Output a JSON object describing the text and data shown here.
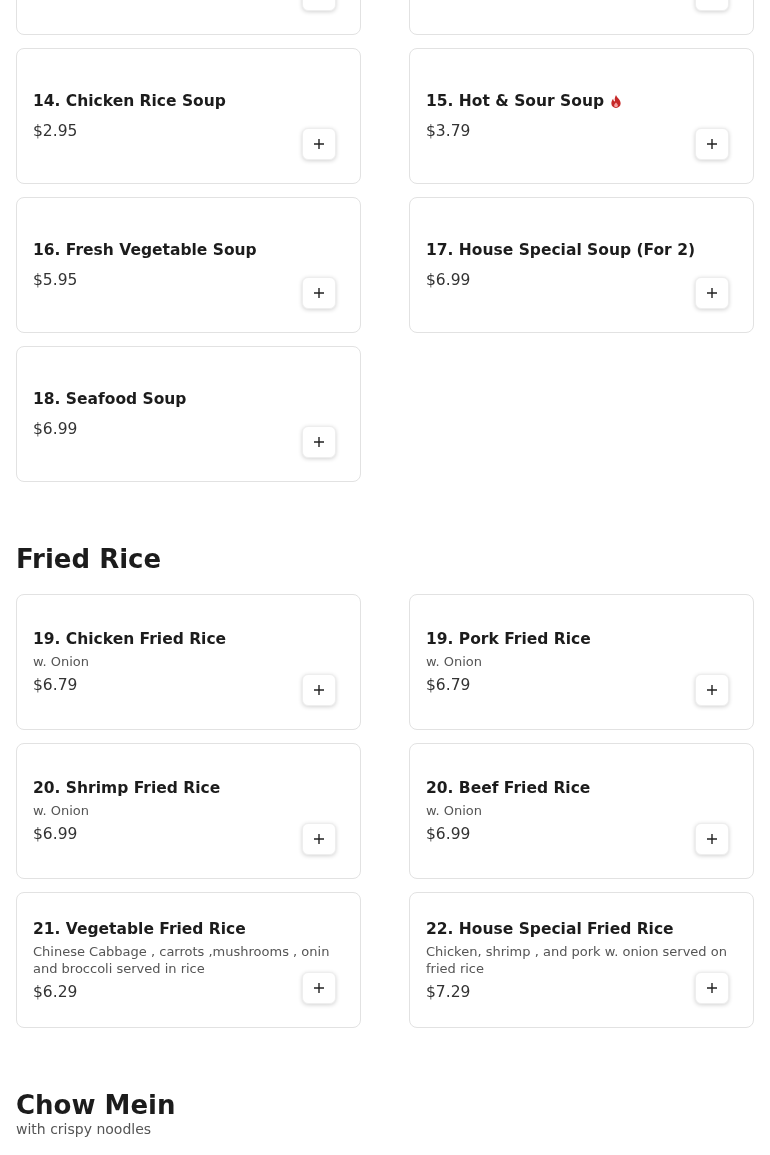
{
  "sections": [
    {
      "items": [
        {
          "kind": "cut"
        },
        {
          "kind": "cut"
        },
        {
          "kind": "dish",
          "name": "14. Chicken Rice Soup",
          "price": "$2.95",
          "spicy": false
        },
        {
          "kind": "dish",
          "name": "15. Hot & Sour Soup",
          "price": "$3.79",
          "spicy": true
        },
        {
          "kind": "dish",
          "name": "16. Fresh Vegetable Soup",
          "price": "$5.95",
          "spicy": false
        },
        {
          "kind": "dish",
          "name": "17. House Special Soup (For 2)",
          "price": "$6.99",
          "spicy": false
        },
        {
          "kind": "dish",
          "name": "18. Seafood Soup",
          "price": "$6.99",
          "spicy": false
        }
      ]
    },
    {
      "title": "Fried Rice",
      "items": [
        {
          "kind": "dish",
          "name": "19. Chicken Fried Rice",
          "description": "w. Onion",
          "price": "$6.79",
          "spicy": false
        },
        {
          "kind": "dish",
          "name": "19. Pork Fried Rice",
          "description": "w. Onion",
          "price": "$6.79",
          "spicy": false
        },
        {
          "kind": "dish",
          "name": "20. Shrimp Fried Rice",
          "description": "w. Onion",
          "price": "$6.99",
          "spicy": false
        },
        {
          "kind": "dish",
          "name": "20. Beef Fried Rice",
          "description": "w. Onion",
          "price": "$6.99",
          "spicy": false
        },
        {
          "kind": "dish",
          "name": "21. Vegetable Fried Rice",
          "description": "Chinese Cabbage , carrots ,mushrooms , onin and broccoli served in rice",
          "price": "$6.29",
          "spicy": false
        },
        {
          "kind": "dish",
          "name": "22. House Special Fried Rice",
          "description": "Chicken, shrimp , and pork w. onion served on fried rice",
          "price": "$7.29",
          "spicy": false
        }
      ]
    },
    {
      "title": "Chow Mein",
      "subtitle": "with crispy noodles"
    }
  ]
}
